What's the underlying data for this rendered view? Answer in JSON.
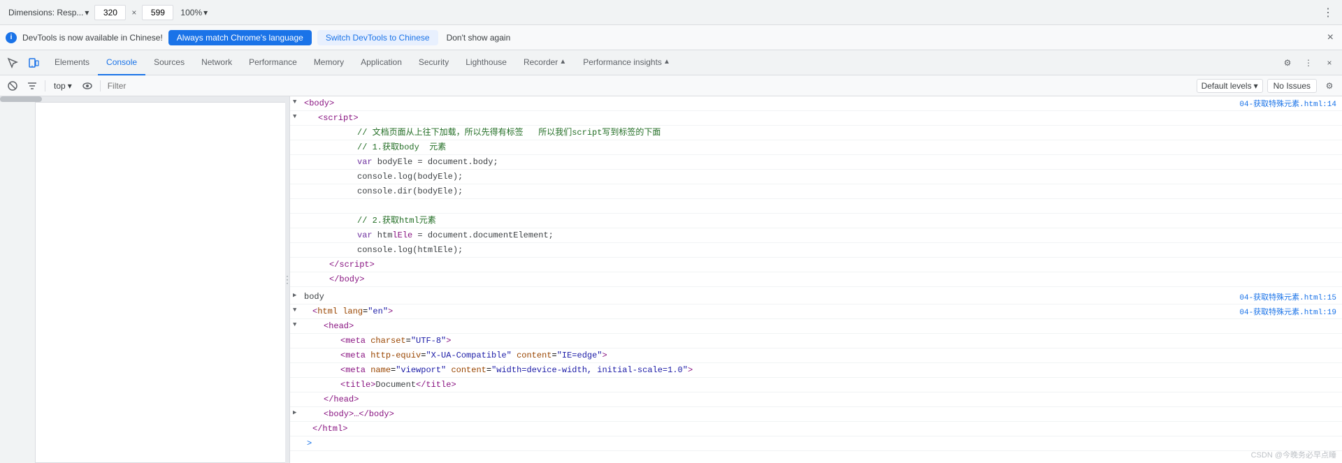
{
  "topBar": {
    "dimensionsLabel": "Dimensions: Resp...",
    "width": "320",
    "height": "599",
    "zoom": "100%",
    "moreIcon": "⋮"
  },
  "notificationBar": {
    "infoIcon": "i",
    "message": "DevTools is now available in Chinese!",
    "btn1": "Always match Chrome's language",
    "btn2": "Switch DevTools to Chinese",
    "dismiss": "Don't show again",
    "closeIcon": "×"
  },
  "tabs": {
    "inspectorIcon": "☰",
    "deviceIcon": "📱",
    "items": [
      {
        "id": "elements",
        "label": "Elements",
        "active": false
      },
      {
        "id": "console",
        "label": "Console",
        "active": true
      },
      {
        "id": "sources",
        "label": "Sources",
        "active": false
      },
      {
        "id": "network",
        "label": "Network",
        "active": false
      },
      {
        "id": "performance",
        "label": "Performance",
        "active": false
      },
      {
        "id": "memory",
        "label": "Memory",
        "active": false
      },
      {
        "id": "application",
        "label": "Application",
        "active": false
      },
      {
        "id": "security",
        "label": "Security",
        "active": false
      },
      {
        "id": "lighthouse",
        "label": "Lighthouse",
        "active": false
      },
      {
        "id": "recorder",
        "label": "Recorder",
        "active": false
      },
      {
        "id": "performance-insights",
        "label": "Performance insights",
        "active": false
      }
    ],
    "settingsIcon": "⚙",
    "moreIcon": "⋮",
    "closeIcon": "×"
  },
  "consoleToolbar": {
    "clearBtn": "🚫",
    "filterPlaceholder": "Filter",
    "contextLabel": "top",
    "eyeIcon": "👁",
    "defaultLevels": "Default levels",
    "noIssues": "No Issues"
  },
  "codeContent": {
    "lines": [
      {
        "indent": 0,
        "expand": true,
        "expanded": true,
        "html": "<span class='tag'>&lt;body&gt;</span>",
        "source": ""
      },
      {
        "indent": 1,
        "expand": true,
        "expanded": true,
        "html": "<span class='tag'>&lt;script&gt;</span>",
        "source": ""
      },
      {
        "indent": 2,
        "expand": false,
        "html": "<span class='comment'>// 文档页面从上往下加载，所以先得有标签&nbsp;&nbsp;&nbsp;所以我们script写到标签的下面</span>",
        "source": ""
      },
      {
        "indent": 2,
        "expand": false,
        "html": "<span class='comment'>// 1.获取body&nbsp;&nbsp;元素</span>",
        "source": ""
      },
      {
        "indent": 2,
        "expand": false,
        "html": "<span class='keyword'>var</span> <span class='text-default'>bodyEle = document.body;</span>",
        "source": ""
      },
      {
        "indent": 2,
        "expand": false,
        "html": "<span class='text-default'>console.log(bodyEle);</span>",
        "source": ""
      },
      {
        "indent": 2,
        "expand": false,
        "html": "<span class='text-default'>console.dir(bodyEle);</span>",
        "source": ""
      },
      {
        "indent": 2,
        "expand": false,
        "html": "",
        "source": ""
      },
      {
        "indent": 2,
        "expand": false,
        "html": "<span class='comment'>// 2.获取html元素</span>",
        "source": ""
      },
      {
        "indent": 2,
        "expand": false,
        "html": "<span class='keyword'>var</span> <span class='text-default'>htm</span><span class='tag'>lEle</span><span class='text-default'> = document.documentElement;</span>",
        "source": ""
      },
      {
        "indent": 2,
        "expand": false,
        "html": "<span class='text-default'>console.log(htmlEle);</span>",
        "source": ""
      },
      {
        "indent": 1,
        "expand": false,
        "html": "<span class='tag'>&lt;/script&gt;</span>",
        "source": ""
      },
      {
        "indent": 1,
        "expand": false,
        "html": "<span class='tag'>&lt;/body&gt;</span>",
        "source": ""
      }
    ],
    "bodyEntry": {
      "label": "body",
      "source": "04-获取特殊元素.html:15"
    },
    "htmlEntry": {
      "expand": true,
      "html": "<span class='attr-name'>html</span> <span class='attr-name'>lang</span>=<span class='attr-value'>\"en\"</span><span class='tag'>&gt;</span>",
      "source": "04-获取特殊元素.html:19"
    },
    "headExpand": {
      "html": "<span class='tag'>&lt;head&gt;</span>"
    },
    "metaLines": [
      "<span class='tag'>&lt;meta</span> <span class='attr-name'>charset</span>=<span class='attr-value'>\"UTF-8\"</span><span class='tag'>&gt;</span>",
      "<span class='tag'>&lt;meta</span> <span class='attr-name'>http-equiv</span>=<span class='attr-value'>\"X-UA-Compatible\"</span> <span class='attr-name'>content</span>=<span class='attr-value'>\"IE=edge\"</span><span class='tag'>&gt;</span>",
      "<span class='tag'>&lt;meta</span> <span class='attr-name'>name</span>=<span class='attr-value'>\"viewport\"</span> <span class='attr-name'>content</span>=<span class='attr-value'>\"width=device-width, initial-scale=1.0\"</span><span class='tag'>&gt;</span>",
      "<span class='tag'>&lt;title&gt;</span><span class='text-default'>Document</span><span class='tag'>&lt;/title&gt;</span>"
    ],
    "caretIndicator": ">"
  },
  "fileLinks": {
    "link1": "04-获取特殊元素.html:14",
    "link2": "04-获取特殊元素.html:15",
    "link3": "04-获取特殊元素.html:19"
  },
  "watermark": "CSDN @今晚务必早点睡"
}
